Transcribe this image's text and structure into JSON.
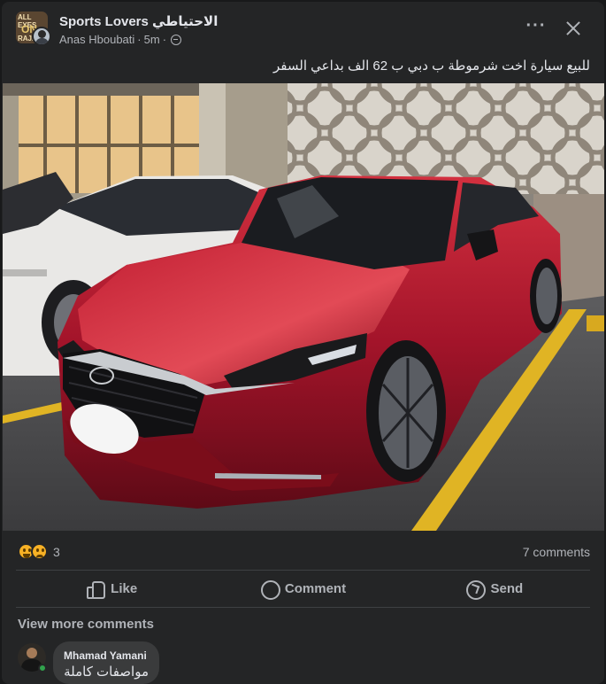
{
  "post": {
    "group_name": "Sports Lovers الاحتياطي",
    "group_avatar_text": [
      "ALL EYES",
      "ON",
      "RAJA"
    ],
    "author": "Anas Hboubati",
    "time": "5m",
    "separator": "·",
    "privacy_icon": "globe-icon",
    "text": "للبيع سيارة اخت شرموطة ب دبي ب 62 الف بداعي السفر",
    "photo_description_icon": "car-photo",
    "reactions": {
      "icons": [
        "laugh-emoji",
        "sad-emoji"
      ],
      "count": "3"
    },
    "comments_count": "7 comments"
  },
  "actions": {
    "like": "Like",
    "comment": "Comment",
    "send": "Send"
  },
  "comments": {
    "view_more": "View more comments",
    "items": [
      {
        "author": "Mhamad Yamani",
        "text": "مواصفات كاملة",
        "online": true
      }
    ]
  },
  "colors": {
    "card_bg": "#242526",
    "text_primary": "#e4e6eb",
    "text_secondary": "#b0b3b8",
    "bubble_bg": "#3a3b3c",
    "online_green": "#31a24c",
    "car_red": "#b3182a"
  }
}
